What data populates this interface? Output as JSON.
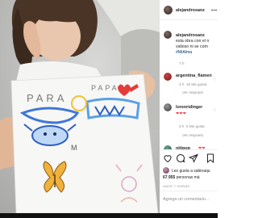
{
  "post": {
    "author": "alejandrosanz",
    "header_more_icon": "ellipsis-horizontal-icon",
    "caption": {
      "author": "alejandrosanz",
      "line1": "esta obra con el n",
      "line2": "valioso ni se com",
      "hashtag": "#MiAlma",
      "age": "7 h"
    },
    "comments": [
      {
        "user": "argentina_flamen",
        "age": "3 h",
        "likes": "16 Me gusta",
        "reply": "Ver respuest",
        "text": ""
      },
      {
        "user": "lorenridinger",
        "age": "4 h",
        "likes": "5 Me gusta",
        "reply": "Ver respuest",
        "text": "❤❤❤"
      },
      {
        "user": "nitipop",
        "age": "",
        "likes": "",
        "reply": "",
        "text": "❤❤"
      }
    ],
    "likes_line1": "Les gusta a sabinaqu",
    "likes_count": "67.955",
    "likes_line2_rest": "personas má",
    "time_ago": "HACE 7 HORAS",
    "comment_placeholder": "Agrega un comentario..."
  },
  "photo": {
    "drawing_text_left": "PARA",
    "drawing_text_right": "PAPA",
    "drawing_letter": "M"
  },
  "icons": {
    "like": "heart-icon",
    "comment": "comment-icon",
    "share": "share-icon",
    "save": "bookmark-icon"
  },
  "colors": {
    "link": "#00376b",
    "muted": "#8e8e8e",
    "heart_red": "#ed4956",
    "border": "#efefef"
  }
}
